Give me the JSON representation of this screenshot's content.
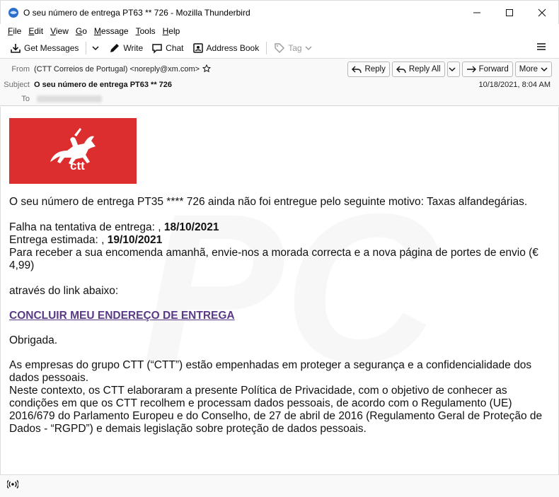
{
  "window": {
    "title": "O seu número de entrega PT63 ** 726 - Mozilla Thunderbird"
  },
  "menu": {
    "items": [
      {
        "label": "File",
        "accel": "F",
        "rest": "ile"
      },
      {
        "label": "Edit",
        "accel": "E",
        "rest": "dit"
      },
      {
        "label": "View",
        "accel": "V",
        "rest": "iew"
      },
      {
        "label": "Go",
        "accel": "G",
        "rest": "o"
      },
      {
        "label": "Message",
        "accel": "M",
        "rest": "essage"
      },
      {
        "label": "Tools",
        "accel": "T",
        "rest": "ools"
      },
      {
        "label": "Help",
        "accel": "H",
        "rest": "elp"
      }
    ]
  },
  "toolbar": {
    "get_messages": "Get Messages",
    "write": "Write",
    "chat": "Chat",
    "address_book": "Address Book",
    "tag": "Tag"
  },
  "header": {
    "from_label": "From",
    "from_value": "(CTT Correios de Portugal) <noreply@xm.com>",
    "subject_label": "Subject",
    "subject_value": "O seu número de entrega PT63 ** 726",
    "to_label": "To",
    "date": "10/18/2021, 8:04 AM",
    "reply": "Reply",
    "reply_all": "Reply All",
    "forward": "Forward",
    "more": "More"
  },
  "logo": {
    "text": "ctt",
    "bg_color": "#dc2e2f"
  },
  "body": {
    "line1": "O seu número de entrega PT35 **** 726 ainda não foi entregue pelo seguinte motivo: Taxas alfandegárias.",
    "fail_prefix": "Falha na tentativa de entrega: , ",
    "fail_date": "18/10/2021",
    "est_prefix": "Entrega estimada: , ",
    "est_date": "19/10/2021",
    "receive": "Para receber a sua encomenda amanhã, envie-nos a morada correcta e a nova página de portes de envio (€ 4,99)",
    "via_link": "através do link abaixo:",
    "link_text": "CONCLUIR MEU ENDEREÇO DE ENTREGA",
    "thanks": "Obrigada.",
    "privacy1": "As empresas do grupo CTT (“CTT”) estão empenhadas em proteger a segurança e a confidencialidade dos dados pessoais.",
    "privacy2": "Neste contexto, os CTT elaboraram a presente Política de Privacidade, com o objetivo de conhecer as condições em que os CTT recolhem e processam dados pessoais, de acordo com o Regulamento (UE) 2016/679 do Parlamento Europeu e do Conselho, de 27 de abril de 2016 (Regulamento Geral de Proteção de Dados - “RGPD”) e demais legislação sobre proteção de dados pessoais."
  }
}
